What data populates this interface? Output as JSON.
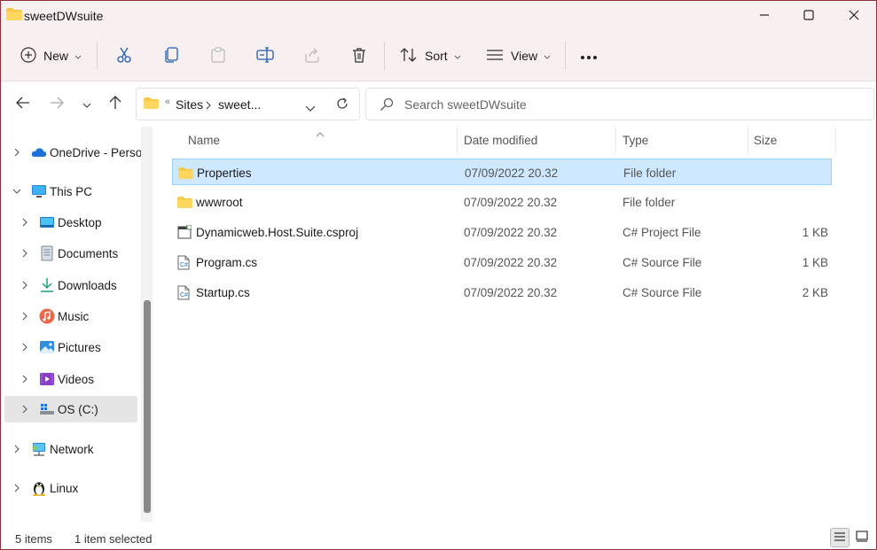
{
  "window": {
    "title": "sweetDWsuite"
  },
  "toolbar": {
    "new_label": "New",
    "sort_label": "Sort",
    "view_label": "View"
  },
  "address": {
    "overflow": "«",
    "crumbs": [
      "Sites",
      "sweet..."
    ]
  },
  "search": {
    "placeholder": "Search sweetDWsuite"
  },
  "nav": {
    "items": [
      {
        "label": "OneDrive - Perso",
        "icon": "onedrive-cloud-icon"
      },
      {
        "label": "This PC",
        "icon": "monitor-icon"
      },
      {
        "label": "Desktop",
        "icon": "desktop-icon"
      },
      {
        "label": "Documents",
        "icon": "documents-icon"
      },
      {
        "label": "Downloads",
        "icon": "download-arrow-icon"
      },
      {
        "label": "Music",
        "icon": "music-icon"
      },
      {
        "label": "Pictures",
        "icon": "pictures-icon"
      },
      {
        "label": "Videos",
        "icon": "videos-icon"
      },
      {
        "label": "OS (C:)",
        "icon": "drive-icon"
      },
      {
        "label": "Network",
        "icon": "network-icon"
      },
      {
        "label": "Linux",
        "icon": "linux-penguin-icon"
      }
    ]
  },
  "columns": {
    "name": "Name",
    "date": "Date modified",
    "type": "Type",
    "size": "Size"
  },
  "files": [
    {
      "name": "Properties",
      "date": "07/09/2022 20.32",
      "type": "File folder",
      "size": "",
      "icon": "folder-icon",
      "selected": true
    },
    {
      "name": "wwwroot",
      "date": "07/09/2022 20.32",
      "type": "File folder",
      "size": "",
      "icon": "folder-icon",
      "selected": false
    },
    {
      "name": "Dynamicweb.Host.Suite.csproj",
      "date": "07/09/2022 20.32",
      "type": "C# Project File",
      "size": "1 KB",
      "icon": "csproj-file-icon",
      "selected": false
    },
    {
      "name": "Program.cs",
      "date": "07/09/2022 20.32",
      "type": "C# Source File",
      "size": "1 KB",
      "icon": "cs-file-icon",
      "selected": false
    },
    {
      "name": "Startup.cs",
      "date": "07/09/2022 20.32",
      "type": "C# Source File",
      "size": "2 KB",
      "icon": "cs-file-icon",
      "selected": false
    }
  ],
  "status": {
    "count": "5 items",
    "selected": "1 item selected"
  },
  "colors": {
    "accent": "#0067c0",
    "selection": "#cde8ff",
    "folder": "#f7c948",
    "chrome": "#f7eff0"
  }
}
